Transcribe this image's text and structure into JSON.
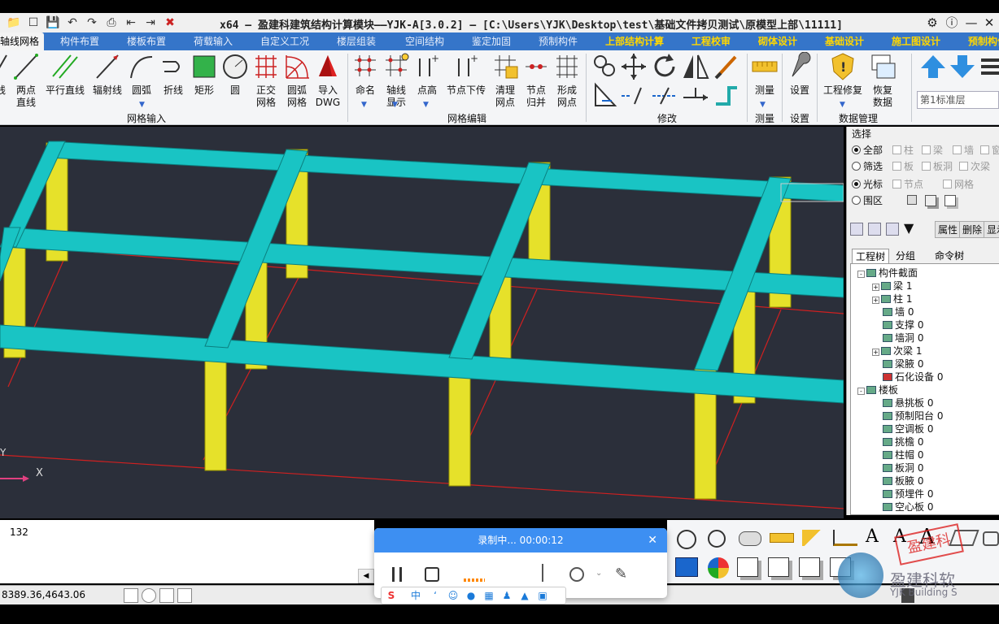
{
  "titlebar": {
    "title": "x64 – 盈建科建筑结构计算模块——YJK-A[3.0.2] – [C:\\Users\\YJK\\Desktop\\test\\基础文件拷贝测试\\原模型上部\\11111]",
    "quick_access_icons": [
      "folder-icon",
      "save-icon",
      "undo-icon",
      "redo-icon",
      "print-icon",
      "import-icon",
      "export-icon",
      "window-icon",
      "close-file-icon"
    ],
    "right_icons": [
      "settings-icon",
      "help-icon",
      "minimize-icon",
      "close-icon"
    ]
  },
  "tabs": [
    {
      "label": "轴线网格",
      "active": true,
      "hl": false
    },
    {
      "label": "构件布置",
      "active": false,
      "hl": false
    },
    {
      "label": "楼板布置",
      "active": false,
      "hl": false
    },
    {
      "label": "荷载输入",
      "active": false,
      "hl": false
    },
    {
      "label": "自定义工况",
      "active": false,
      "hl": false
    },
    {
      "label": "楼层组装",
      "active": false,
      "hl": false
    },
    {
      "label": "空间结构",
      "active": false,
      "hl": false
    },
    {
      "label": "鉴定加固",
      "active": false,
      "hl": false
    },
    {
      "label": "预制构件",
      "active": false,
      "hl": false
    },
    {
      "label": "上部结构计算",
      "active": false,
      "hl": true
    },
    {
      "label": "工程校审",
      "active": false,
      "hl": true
    },
    {
      "label": "砌体设计",
      "active": false,
      "hl": true
    },
    {
      "label": "基础设计",
      "active": false,
      "hl": true
    },
    {
      "label": "施工图设计",
      "active": false,
      "hl": true
    },
    {
      "label": "预制构件",
      "active": false,
      "hl": true
    }
  ],
  "ribbon": {
    "grid_input": {
      "group_label": "网格输入",
      "buttons": [
        "线",
        "两点\n直线",
        "平行直线",
        "辐射线",
        "圆弧",
        "折线",
        "矩形",
        "圆",
        "正交\n网格",
        "圆弧\n网格",
        "导入\nDWG"
      ]
    },
    "grid_edit": {
      "group_label": "网格编辑",
      "buttons": [
        "命名",
        "轴线\n显示",
        "点高",
        "节点下传",
        "清理\n网点",
        "节点\n归并",
        "形成\n网点"
      ]
    },
    "modify": {
      "group_label": "修改"
    },
    "measure": {
      "group_label": "测量",
      "buttons": [
        "测量"
      ]
    },
    "settings": {
      "group_label": "设置",
      "buttons": [
        "设置"
      ]
    },
    "data_mgmt": {
      "group_label": "数据管理",
      "buttons": [
        "工程修复",
        "恢复\n数据"
      ]
    },
    "floor_select": "第1标准层"
  },
  "right_panel": {
    "title": "选择",
    "radios": [
      {
        "label": "全部",
        "on": true
      },
      {
        "label": "筛选",
        "on": false
      },
      {
        "label": "光标",
        "on": true
      },
      {
        "label": "围区",
        "on": false
      }
    ],
    "checks_row1": [
      "柱",
      "梁",
      "墙",
      "窗"
    ],
    "checks_row2": [
      "板",
      "板洞",
      "次梁"
    ],
    "checks_row3": [
      "节点",
      "网格"
    ],
    "buttons": [
      "属性",
      "删除",
      "显示"
    ],
    "tree_tabs": [
      "工程树",
      "分组",
      "命令树"
    ],
    "tree": [
      {
        "label": "构件截面",
        "level": 0,
        "exp": "-"
      },
      {
        "label": "梁 1",
        "level": 1,
        "exp": "+"
      },
      {
        "label": "柱 1",
        "level": 1,
        "exp": "+"
      },
      {
        "label": "墙 0",
        "level": 1,
        "exp": ""
      },
      {
        "label": "支撑 0",
        "level": 1,
        "exp": ""
      },
      {
        "label": "墙洞 0",
        "level": 1,
        "exp": ""
      },
      {
        "label": "次梁 1",
        "level": 1,
        "exp": "+"
      },
      {
        "label": "梁腋 0",
        "level": 1,
        "exp": ""
      },
      {
        "label": "石化设备 0",
        "level": 1,
        "exp": ""
      },
      {
        "label": "楼板",
        "level": 0,
        "exp": "-"
      },
      {
        "label": "悬挑板 0",
        "level": 1,
        "exp": ""
      },
      {
        "label": "预制阳台 0",
        "level": 1,
        "exp": ""
      },
      {
        "label": "空调板 0",
        "level": 1,
        "exp": ""
      },
      {
        "label": "挑檐 0",
        "level": 1,
        "exp": ""
      },
      {
        "label": "柱帽 0",
        "level": 1,
        "exp": ""
      },
      {
        "label": "板洞 0",
        "level": 1,
        "exp": ""
      },
      {
        "label": "板腋 0",
        "level": 1,
        "exp": ""
      },
      {
        "label": "预埋件 0",
        "level": 1,
        "exp": ""
      },
      {
        "label": "空心板 0",
        "level": 1,
        "exp": ""
      }
    ]
  },
  "viewport": {
    "axis_y": "Y",
    "axis_x": "X",
    "beam_color": "#19c4c4",
    "column_color": "#e6e12a",
    "grid_color": "#d02020",
    "background": "#2b2f3a"
  },
  "command": {
    "text": "132"
  },
  "status": {
    "coords": "8389.36,4643.06"
  },
  "recorder": {
    "status": "录制中... 00:00:12"
  },
  "watermark": {
    "brand": "盈建科软",
    "sub": "YJK Building S",
    "stamp": "盈建科"
  }
}
